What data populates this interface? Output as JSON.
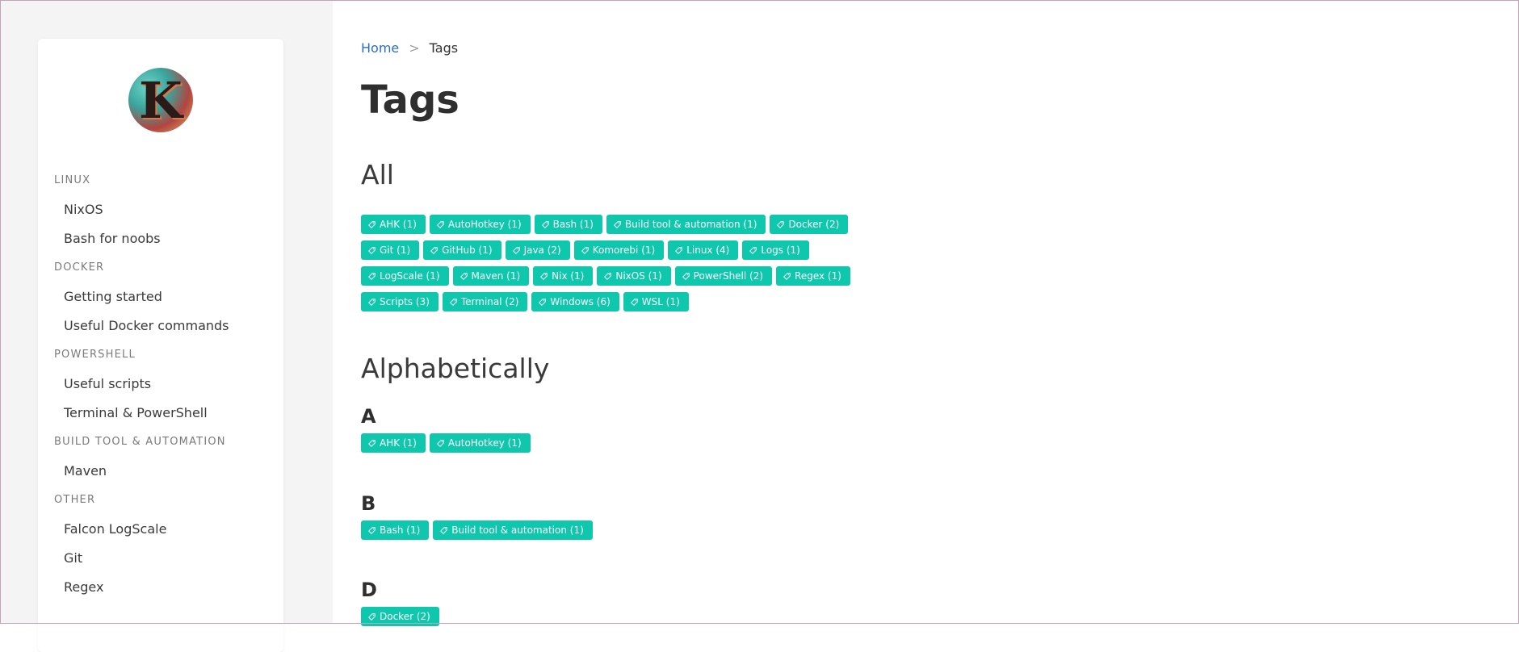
{
  "breadcrumb": {
    "home": "Home",
    "separator": ">",
    "current": "Tags"
  },
  "page_title": "Tags",
  "avatar": {
    "letter": "K"
  },
  "sidebar": {
    "sections": [
      {
        "title": "LINUX",
        "items": [
          "NixOS",
          "Bash for noobs"
        ]
      },
      {
        "title": "DOCKER",
        "items": [
          "Getting started",
          "Useful Docker commands"
        ]
      },
      {
        "title": "POWERSHELL",
        "items": [
          "Useful scripts",
          "Terminal & PowerShell"
        ]
      },
      {
        "title": "BUILD TOOL & AUTOMATION",
        "items": [
          "Maven"
        ]
      },
      {
        "title": "OTHER",
        "items": [
          "Falcon LogScale",
          "Git",
          "Regex"
        ]
      }
    ]
  },
  "all": {
    "heading": "All",
    "rows": [
      [
        "AHK (1)",
        "AutoHotkey (1)",
        "Bash (1)",
        "Build tool & automation (1)",
        "Docker (2)"
      ],
      [
        "Git (1)",
        "GitHub (1)",
        "Java (2)",
        "Komorebi (1)",
        "Linux (4)",
        "Logs (1)"
      ],
      [
        "LogScale (1)",
        "Maven (1)",
        "Nix (1)",
        "NixOS (1)",
        "PowerShell (2)",
        "Regex (1)"
      ],
      [
        "Scripts (3)",
        "Terminal (2)",
        "Windows (6)",
        "WSL (1)"
      ]
    ]
  },
  "alphabetically": {
    "heading": "Alphabetically",
    "groups": [
      {
        "letter": "A",
        "tags": [
          "AHK (1)",
          "AutoHotkey (1)"
        ]
      },
      {
        "letter": "B",
        "tags": [
          "Bash (1)",
          "Build tool & automation (1)"
        ]
      },
      {
        "letter": "D",
        "tags": [
          "Docker (2)"
        ]
      }
    ]
  },
  "icons": {
    "tag": "tag-icon"
  },
  "colors": {
    "tag_bg": "#0fc7ac",
    "link": "#2b6ec9"
  }
}
